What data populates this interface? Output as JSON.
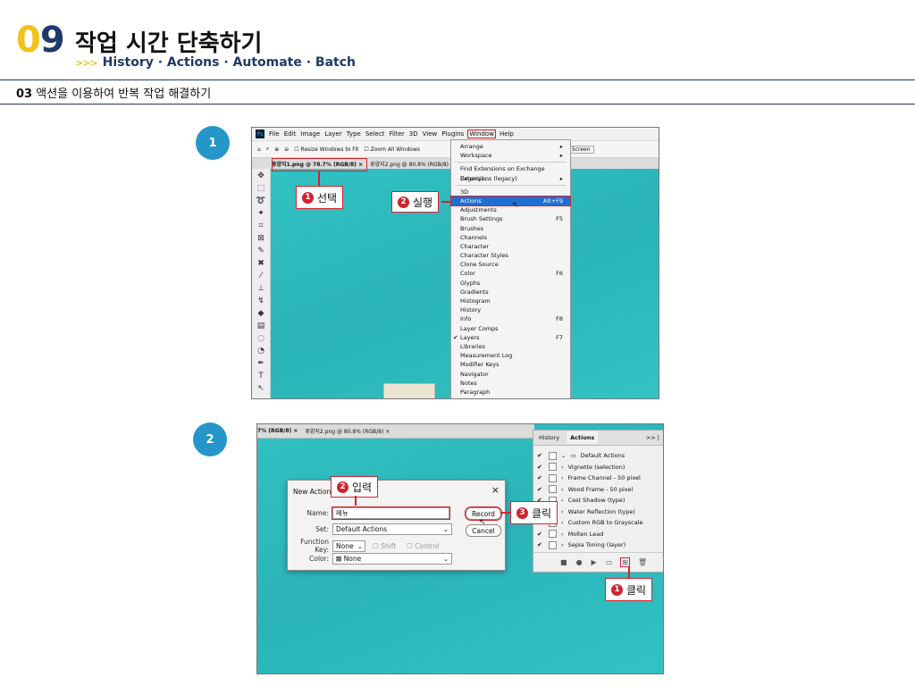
{
  "header": {
    "chapter_d0": "0",
    "chapter_d1": "9",
    "title": "작업 시간 단축하기",
    "arrows": ">>>",
    "subtitle": "History · Actions · Automate · Batch",
    "section_num": "03",
    "section_title": "액션을 이용하여 반복 작업 해결하기"
  },
  "steps": [
    "1",
    "2"
  ],
  "shot1": {
    "menubar": [
      "File",
      "Edit",
      "Image",
      "Layer",
      "Type",
      "Select",
      "Filter",
      "3D",
      "View",
      "Plugins",
      "Window",
      "Help"
    ],
    "ps_logo": "Ps",
    "opt_resize": "Resize Windows to Fit",
    "opt_zoom": "Zoom All Windows",
    "opt_fill": "Fill Screen",
    "tab1": "휴양지1.png @ 78.7% (RGB/8)",
    "tab2": "휴양지2.png @ 80.8% (RGB/8)",
    "tab_close": "×",
    "callout1": {
      "num": "1",
      "text": "선택"
    },
    "callout2": {
      "num": "2",
      "text": "실행"
    },
    "menu": {
      "arrange": "Arrange",
      "workspace": "Workspace",
      "find_ext": "Find Extensions on Exchange (legacy)...",
      "ext_legacy": "Extensions (legacy)",
      "threed": "3D",
      "actions": "Actions",
      "actions_key": "Alt+F9",
      "adjustments": "Adjustments",
      "brush_settings": "Brush Settings",
      "brush_settings_key": "F5",
      "brushes": "Brushes",
      "channels": "Channels",
      "character": "Character",
      "character_styles": "Character Styles",
      "clone_source": "Clone Source",
      "color": "Color",
      "color_key": "F6",
      "glyphs": "Glyphs",
      "gradients": "Gradients",
      "histogram": "Histogram",
      "history": "History",
      "info": "Info",
      "info_key": "F8",
      "layer_comps": "Layer Comps",
      "layers": "Layers",
      "layers_key": "F7",
      "libraries": "Libraries",
      "measurement_log": "Measurement Log",
      "modifier_keys": "Modifier Keys",
      "navigator": "Navigator",
      "notes": "Notes",
      "paragraph": "Paragraph"
    }
  },
  "shot2": {
    "tab1": "7% (RGB/8)",
    "tab2": "휴양지2.png @ 80.8% (RGB/8)",
    "tab_close": "×",
    "panel_tab_history": "History",
    "panel_tab_actions": "Actions",
    "panel_menu": ">> |",
    "actions": [
      "Default Actions",
      "Vignette (selection)",
      "Frame Channel - 50 pixel",
      "Wood Frame - 50 pixel",
      "Cast Shadow (type)",
      "Water Reflection (type)",
      "Custom RGB to Grayscale",
      "Molten Lead",
      "Sepia Toning (layer)"
    ],
    "dialog": {
      "title": "New Action",
      "close": "×",
      "name_label": "Name:",
      "name_value": "메뉴",
      "set_label": "Set:",
      "set_value": "Default Actions",
      "fkey_label": "Function Key:",
      "fkey_value": "None",
      "shift": "Shift",
      "control": "Control",
      "color_label": "Color:",
      "color_value": "None",
      "record": "Record",
      "cancel": "Cancel"
    },
    "callout_input": {
      "num": "2",
      "text": "입력"
    },
    "callout_record": {
      "num": "3",
      "text": "클릭"
    },
    "callout_new": {
      "num": "1",
      "text": "클릭"
    }
  }
}
